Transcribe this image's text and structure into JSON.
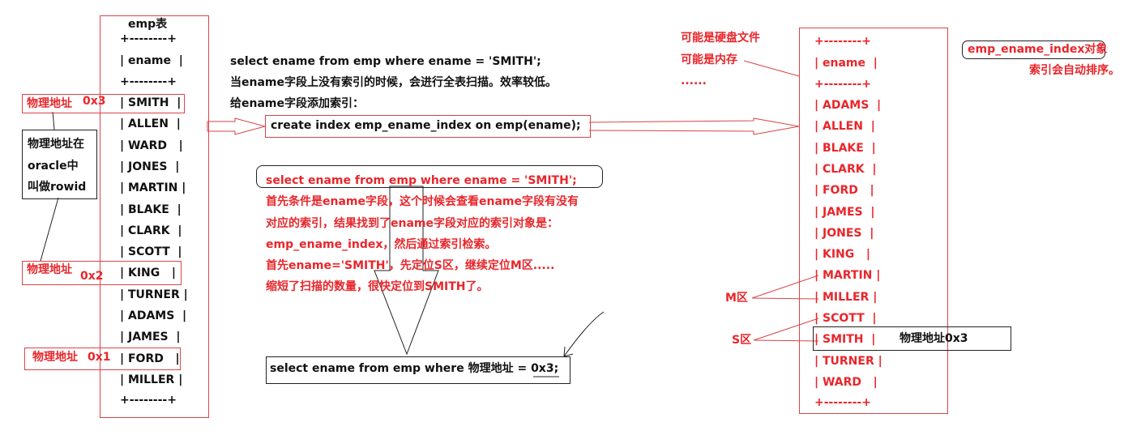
{
  "emp_table": {
    "title": "emp表",
    "border": "+--------+",
    "header": "| ename  |",
    "rows": [
      "| SMITH  |",
      "| ALLEN  |",
      "| WARD   |",
      "| JONES  |",
      "| MARTIN |",
      "| BLAKE  |",
      "| CLARK  |",
      "| SCOTT  |",
      "| KING   |",
      "| TURNER |",
      "| ADAMS  |",
      "| JAMES  |",
      "| FORD   |",
      "| MILLER |"
    ]
  },
  "left_labels": {
    "addr_0x3_label": "物理地址",
    "addr_0x3_value": "0x3",
    "addr_0x2_label": "物理地址",
    "addr_0x2_value": "0x2",
    "addr_0x1_label": "物理地址",
    "addr_0x1_value": "0x1",
    "rowid_note": [
      "物理地址在",
      "oracle中",
      "叫做rowid"
    ]
  },
  "intro": {
    "lines": [
      "select ename from emp where ename = 'SMITH';",
      "当ename字段上没有索引的时候，会进行全表扫描。效率较低。",
      "给ename字段添加索引："
    ],
    "create_index": "create index emp_ename_index on emp(ename);"
  },
  "explanation": {
    "lines": [
      "select ename from emp where ename = 'SMITH';",
      "首先条件是ename字段，这个时候会查看ename字段有没有",
      "对应的索引，结果找到了ename字段对应的索引对象是：",
      "emp_ename_index，然后通过索引检索。",
      "首先ename='SMITH'，先定位S区，继续定位M区.....",
      "缩短了扫描的数量，很快定位到SMITH了。"
    ],
    "final_query_prefix": "select ename from emp where 物理地址 = ",
    "final_query_value": "0x3;"
  },
  "storage_notes": [
    "可能是硬盘文件",
    "可能是内存",
    "......"
  ],
  "index_table": {
    "title": "emp_ename_index对象",
    "subtitle": "索引会自动排序。",
    "border": "+--------+",
    "header": "| ename  |",
    "rows": [
      "| ADAMS  |",
      "| ALLEN  |",
      "| BLAKE  |",
      "| CLARK  |",
      "| FORD   |",
      "| JAMES  |",
      "| JONES  |",
      "| KING   |",
      "| MARTIN |",
      "| MILLER |",
      "| SCOTT  |",
      "| SMITH  |",
      "| TURNER |",
      "| WARD   |"
    ],
    "m_zone": "M区",
    "s_zone": "S区",
    "smith_addr": "物理地址0x3"
  },
  "colors": {
    "red": "#e8262b",
    "black": "#111111",
    "box_red": "#d9444a"
  }
}
